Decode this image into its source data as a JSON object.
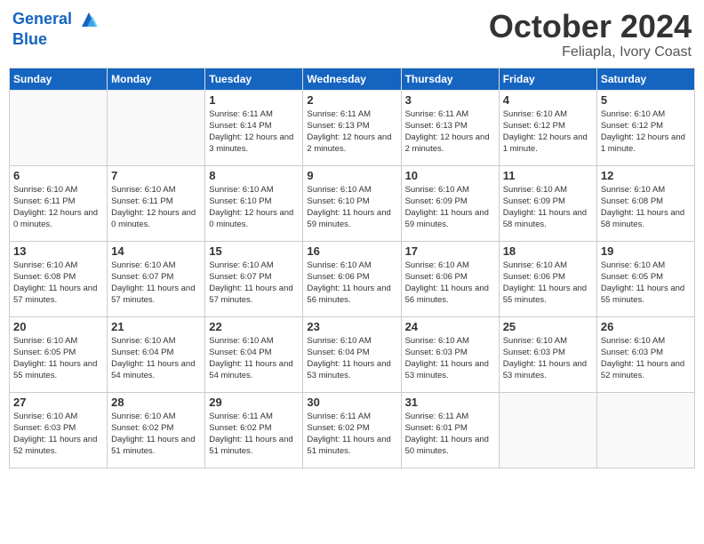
{
  "logo": {
    "line1": "General",
    "line2": "Blue"
  },
  "title": "October 2024",
  "location": "Feliapla, Ivory Coast",
  "weekdays": [
    "Sunday",
    "Monday",
    "Tuesday",
    "Wednesday",
    "Thursday",
    "Friday",
    "Saturday"
  ],
  "weeks": [
    [
      {
        "day": "",
        "info": ""
      },
      {
        "day": "",
        "info": ""
      },
      {
        "day": "1",
        "info": "Sunrise: 6:11 AM\nSunset: 6:14 PM\nDaylight: 12 hours\nand 3 minutes."
      },
      {
        "day": "2",
        "info": "Sunrise: 6:11 AM\nSunset: 6:13 PM\nDaylight: 12 hours\nand 2 minutes."
      },
      {
        "day": "3",
        "info": "Sunrise: 6:11 AM\nSunset: 6:13 PM\nDaylight: 12 hours\nand 2 minutes."
      },
      {
        "day": "4",
        "info": "Sunrise: 6:10 AM\nSunset: 6:12 PM\nDaylight: 12 hours\nand 1 minute."
      },
      {
        "day": "5",
        "info": "Sunrise: 6:10 AM\nSunset: 6:12 PM\nDaylight: 12 hours\nand 1 minute."
      }
    ],
    [
      {
        "day": "6",
        "info": "Sunrise: 6:10 AM\nSunset: 6:11 PM\nDaylight: 12 hours\nand 0 minutes."
      },
      {
        "day": "7",
        "info": "Sunrise: 6:10 AM\nSunset: 6:11 PM\nDaylight: 12 hours\nand 0 minutes."
      },
      {
        "day": "8",
        "info": "Sunrise: 6:10 AM\nSunset: 6:10 PM\nDaylight: 12 hours\nand 0 minutes."
      },
      {
        "day": "9",
        "info": "Sunrise: 6:10 AM\nSunset: 6:10 PM\nDaylight: 11 hours\nand 59 minutes."
      },
      {
        "day": "10",
        "info": "Sunrise: 6:10 AM\nSunset: 6:09 PM\nDaylight: 11 hours\nand 59 minutes."
      },
      {
        "day": "11",
        "info": "Sunrise: 6:10 AM\nSunset: 6:09 PM\nDaylight: 11 hours\nand 58 minutes."
      },
      {
        "day": "12",
        "info": "Sunrise: 6:10 AM\nSunset: 6:08 PM\nDaylight: 11 hours\nand 58 minutes."
      }
    ],
    [
      {
        "day": "13",
        "info": "Sunrise: 6:10 AM\nSunset: 6:08 PM\nDaylight: 11 hours\nand 57 minutes."
      },
      {
        "day": "14",
        "info": "Sunrise: 6:10 AM\nSunset: 6:07 PM\nDaylight: 11 hours\nand 57 minutes."
      },
      {
        "day": "15",
        "info": "Sunrise: 6:10 AM\nSunset: 6:07 PM\nDaylight: 11 hours\nand 57 minutes."
      },
      {
        "day": "16",
        "info": "Sunrise: 6:10 AM\nSunset: 6:06 PM\nDaylight: 11 hours\nand 56 minutes."
      },
      {
        "day": "17",
        "info": "Sunrise: 6:10 AM\nSunset: 6:06 PM\nDaylight: 11 hours\nand 56 minutes."
      },
      {
        "day": "18",
        "info": "Sunrise: 6:10 AM\nSunset: 6:06 PM\nDaylight: 11 hours\nand 55 minutes."
      },
      {
        "day": "19",
        "info": "Sunrise: 6:10 AM\nSunset: 6:05 PM\nDaylight: 11 hours\nand 55 minutes."
      }
    ],
    [
      {
        "day": "20",
        "info": "Sunrise: 6:10 AM\nSunset: 6:05 PM\nDaylight: 11 hours\nand 55 minutes."
      },
      {
        "day": "21",
        "info": "Sunrise: 6:10 AM\nSunset: 6:04 PM\nDaylight: 11 hours\nand 54 minutes."
      },
      {
        "day": "22",
        "info": "Sunrise: 6:10 AM\nSunset: 6:04 PM\nDaylight: 11 hours\nand 54 minutes."
      },
      {
        "day": "23",
        "info": "Sunrise: 6:10 AM\nSunset: 6:04 PM\nDaylight: 11 hours\nand 53 minutes."
      },
      {
        "day": "24",
        "info": "Sunrise: 6:10 AM\nSunset: 6:03 PM\nDaylight: 11 hours\nand 53 minutes."
      },
      {
        "day": "25",
        "info": "Sunrise: 6:10 AM\nSunset: 6:03 PM\nDaylight: 11 hours\nand 53 minutes."
      },
      {
        "day": "26",
        "info": "Sunrise: 6:10 AM\nSunset: 6:03 PM\nDaylight: 11 hours\nand 52 minutes."
      }
    ],
    [
      {
        "day": "27",
        "info": "Sunrise: 6:10 AM\nSunset: 6:03 PM\nDaylight: 11 hours\nand 52 minutes."
      },
      {
        "day": "28",
        "info": "Sunrise: 6:10 AM\nSunset: 6:02 PM\nDaylight: 11 hours\nand 51 minutes."
      },
      {
        "day": "29",
        "info": "Sunrise: 6:11 AM\nSunset: 6:02 PM\nDaylight: 11 hours\nand 51 minutes."
      },
      {
        "day": "30",
        "info": "Sunrise: 6:11 AM\nSunset: 6:02 PM\nDaylight: 11 hours\nand 51 minutes."
      },
      {
        "day": "31",
        "info": "Sunrise: 6:11 AM\nSunset: 6:01 PM\nDaylight: 11 hours\nand 50 minutes."
      },
      {
        "day": "",
        "info": ""
      },
      {
        "day": "",
        "info": ""
      }
    ]
  ]
}
